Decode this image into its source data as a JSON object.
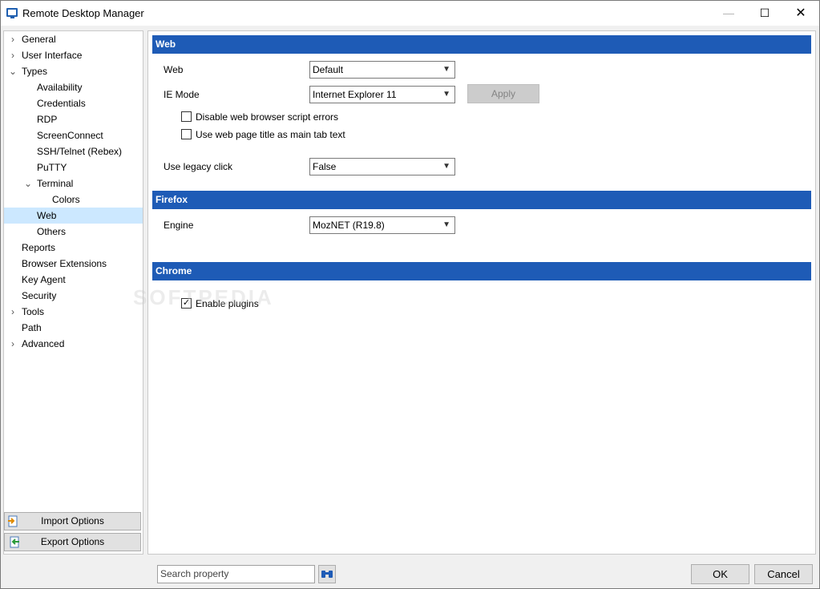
{
  "window": {
    "title": "Remote Desktop Manager",
    "minimize_icon": "minimize-icon",
    "maximize_icon": "maximize-icon",
    "close_icon": "close-icon",
    "min_glyph": "—",
    "max_glyph": "☐",
    "close_glyph": "✕"
  },
  "tree": {
    "items": [
      {
        "label": "General",
        "expander": "›",
        "level": 0
      },
      {
        "label": "User Interface",
        "expander": "›",
        "level": 0
      },
      {
        "label": "Types",
        "expander": "⌄",
        "level": 0
      },
      {
        "label": "Availability",
        "expander": "",
        "level": 1
      },
      {
        "label": "Credentials",
        "expander": "",
        "level": 1
      },
      {
        "label": "RDP",
        "expander": "",
        "level": 1
      },
      {
        "label": "ScreenConnect",
        "expander": "",
        "level": 1
      },
      {
        "label": "SSH/Telnet (Rebex)",
        "expander": "",
        "level": 1
      },
      {
        "label": "PuTTY",
        "expander": "",
        "level": 1
      },
      {
        "label": "Terminal",
        "expander": "⌄",
        "level": 1
      },
      {
        "label": "Colors",
        "expander": "",
        "level": 2
      },
      {
        "label": "Web",
        "expander": "",
        "level": 1,
        "selected": true
      },
      {
        "label": "Others",
        "expander": "",
        "level": 1
      },
      {
        "label": "Reports",
        "expander": "",
        "level": 0
      },
      {
        "label": "Browser Extensions",
        "expander": "",
        "level": 0
      },
      {
        "label": "Key Agent",
        "expander": "",
        "level": 0
      },
      {
        "label": "Security",
        "expander": "",
        "level": 0
      },
      {
        "label": "Tools",
        "expander": "›",
        "level": 0
      },
      {
        "label": "Path",
        "expander": "",
        "level": 0
      },
      {
        "label": "Advanced",
        "expander": "›",
        "level": 0
      }
    ]
  },
  "side_buttons": {
    "import_label": "Import Options",
    "export_label": "Export Options"
  },
  "sections": {
    "web": {
      "header": "Web",
      "web_label": "Web",
      "web_value": "Default",
      "ie_mode_label": "IE Mode",
      "ie_mode_value": "Internet Explorer 11",
      "apply_label": "Apply",
      "disable_script_errors_label": "Disable web browser script errors",
      "disable_script_errors_checked": false,
      "use_page_title_label": "Use web page title as main tab text",
      "use_page_title_checked": false,
      "legacy_click_label": "Use legacy click",
      "legacy_click_value": "False"
    },
    "firefox": {
      "header": "Firefox",
      "engine_label": "Engine",
      "engine_value": "MozNET (R19.8)"
    },
    "chrome": {
      "header": "Chrome",
      "enable_plugins_label": "Enable plugins",
      "enable_plugins_checked": true,
      "check_glyph": "✓"
    }
  },
  "watermark": "SOFTPEDIA",
  "footer": {
    "search_text": "Search property",
    "ok_label": "OK",
    "cancel_label": "Cancel"
  },
  "colors": {
    "section_header": "#1e5bb6",
    "selected_row": "#cce8ff"
  }
}
